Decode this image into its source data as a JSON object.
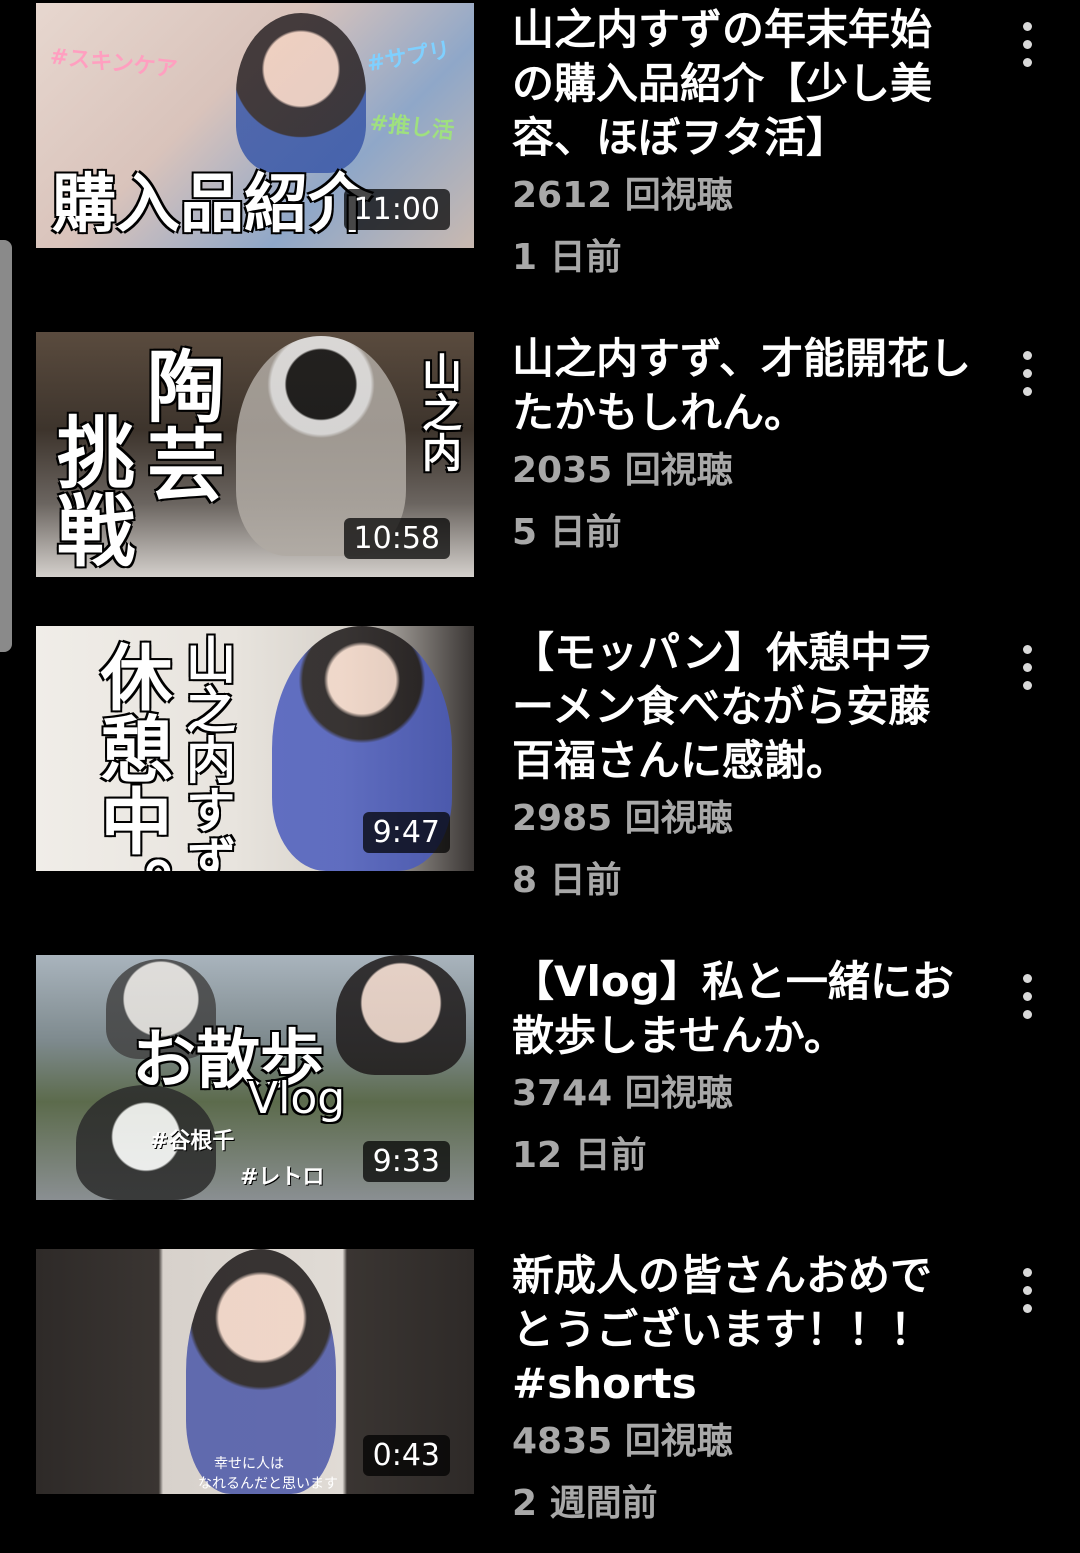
{
  "videos": [
    {
      "title": "山之内すずの年末年始の購入品紹介【少し美容、ほぼヲタ活】",
      "views": "2612 回視聴",
      "age": "1 日前",
      "duration": "11:00",
      "thumbnail": {
        "big_text": "購入品紹介",
        "tags": [
          "#スキンケア",
          "#サプリ",
          "#推し活"
        ]
      }
    },
    {
      "title": "山之内すず、才能開花したかもしれん。",
      "views": "2035 回視聴",
      "age": "5 日前",
      "duration": "10:58",
      "thumbnail": {
        "big_text_1": "陶芸",
        "big_text_2": "挑戦",
        "side_text": "山之内"
      }
    },
    {
      "title": "【モッパン】休憩中ラーメン食べながら安藤百福さんに感謝。",
      "views": "2985 回視聴",
      "age": "8 日前",
      "duration": "9:47",
      "thumbnail": {
        "big_text": "休憩中。",
        "side_text": "山之内すず、"
      }
    },
    {
      "title": "【Vlog】私と一緒にお散歩しませんか。",
      "views": "3744 回視聴",
      "age": "12 日前",
      "duration": "9:33",
      "thumbnail": {
        "big_text": "お散歩",
        "sub_text": "Vlog",
        "tags": [
          "#谷根千",
          "#レトロ"
        ]
      }
    },
    {
      "title": "新成人の皆さんおめでとうございます！！！ #shorts",
      "views": "4835 回視聴",
      "age": "2 週間前",
      "duration": "0:43",
      "thumbnail": {
        "caption_1": "幸せに人は",
        "caption_2": "なれるんだと思います"
      }
    }
  ],
  "colors": {
    "background": "#000000",
    "title": "#ffffff",
    "meta": "#a8a8a8",
    "duration_bg": "#000000"
  },
  "icons": {
    "menu": "more-vert-icon"
  }
}
